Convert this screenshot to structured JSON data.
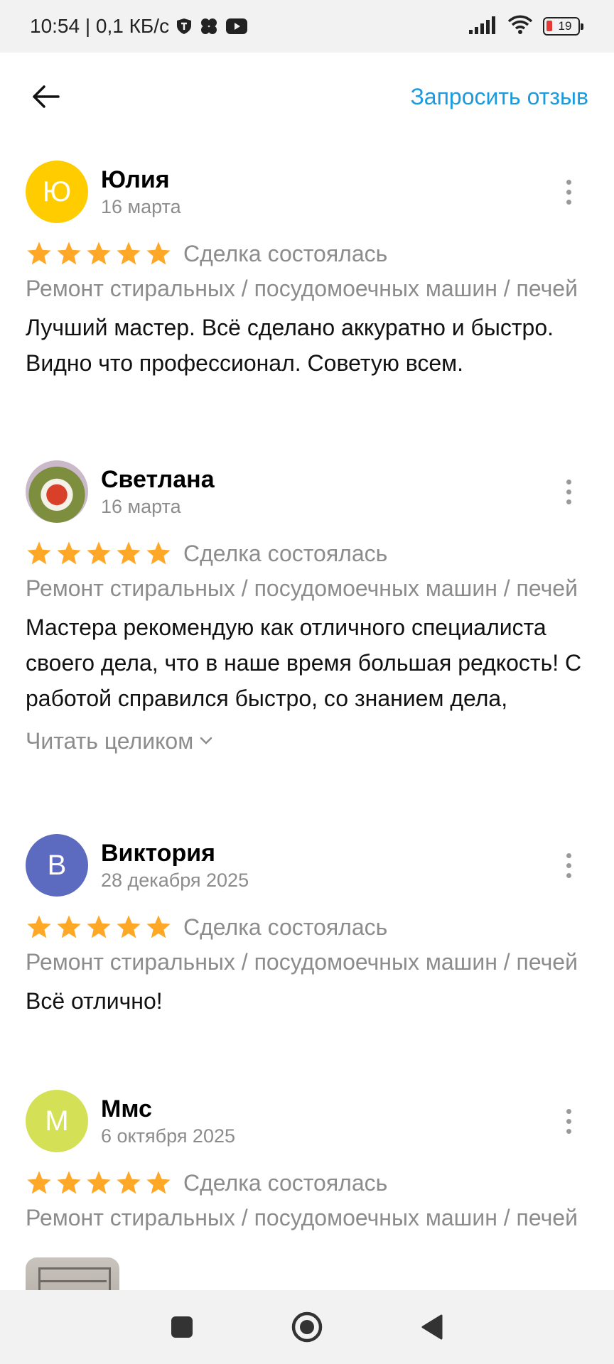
{
  "status_bar": {
    "time_info": "10:54 | 0,1 КБ/с",
    "battery": "19",
    "battery_color": "#e53935"
  },
  "header": {
    "back_icon": "arrow-left-icon",
    "request_review_label": "Запросить отзыв",
    "accent_color": "#1a9be0"
  },
  "reviews": [
    {
      "author": "Юлия",
      "initial": "Ю",
      "avatar_color": "#ffcc00",
      "date": "16 марта",
      "rating": 5,
      "deal_status": "Сделка состоялась",
      "category": "Ремонт стиральных / посудомоечных машин / печей",
      "text": "Лучший мастер. Всё сделано аккуратно и быстро. Видно что профессионал. Советую всем."
    },
    {
      "author": "Светлана",
      "initial": "",
      "avatar_color": "#6b7a3c",
      "date": "16 марта",
      "rating": 5,
      "deal_status": "Сделка состоялась",
      "category": "Ремонт стиральных / посудомоечных машин / печей",
      "text": "Мастера рекомендую как отличного специалиста своего дела, что в наше время большая редкость! С работой справился быстро, со знанием дела,",
      "read_more": "Читать целиком"
    },
    {
      "author": "Виктория",
      "initial": "В",
      "avatar_color": "#5c6bc0",
      "date": "28 декабря 2025",
      "rating": 5,
      "deal_status": "Сделка состоялась",
      "category": "Ремонт стиральных / посудомоечных машин / печей",
      "text": "Всё отлично!"
    },
    {
      "author": "Ммс",
      "initial": "М",
      "avatar_color": "#d4e157",
      "date": "6 октября 2025",
      "rating": 5,
      "deal_status": "Сделка состоялась",
      "category": "Ремонт стиральных / посудомоечных машин / печей"
    }
  ],
  "star_color": "#ffa726",
  "nav_bar": {
    "recents_icon": "square-icon",
    "home_icon": "circle-home-icon",
    "back_icon": "triangle-back-icon"
  }
}
